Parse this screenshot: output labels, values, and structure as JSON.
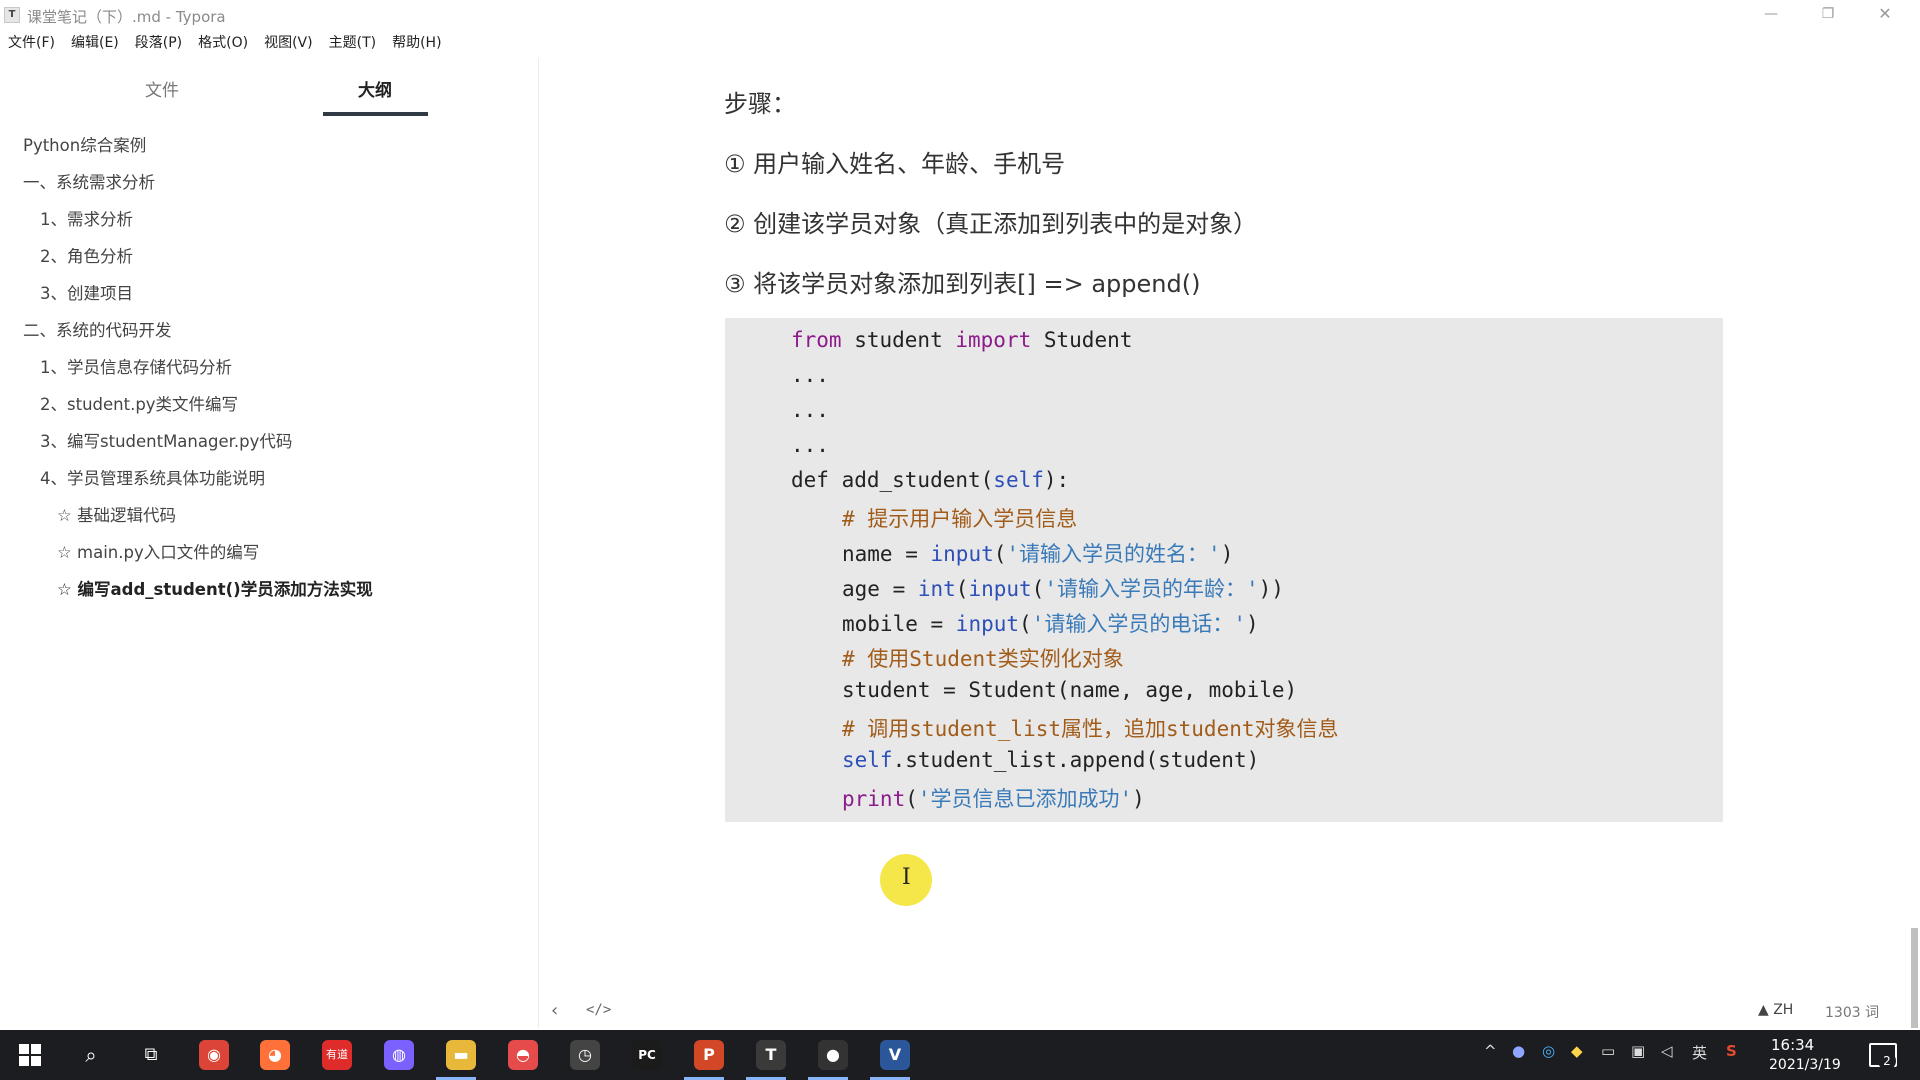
{
  "window": {
    "title": "课堂笔记（下）.md - Typora",
    "app_icon_letter": "T",
    "controls": {
      "minimize": "—",
      "maximize": "❐",
      "close": "✕"
    }
  },
  "menu": [
    "文件(F)",
    "编辑(E)",
    "段落(P)",
    "格式(O)",
    "视图(V)",
    "主题(T)",
    "帮助(H)"
  ],
  "sidebar": {
    "tabs": {
      "files": "文件",
      "outline": "大纲"
    },
    "outline": [
      "Python综合案例",
      "一、系统需求分析",
      "1、需求分析",
      "2、角色分析",
      "3、创建项目",
      "二、系统的代码开发",
      "1、学员信息存储代码分析",
      "2、student.py类文件编写",
      "3、编写studentManager.py代码",
      "4、学员管理系统具体功能说明",
      "☆ 基础逻辑代码",
      "☆ main.py入口文件的编写",
      "☆ 编写add_student()学员添加方法实现"
    ]
  },
  "content": {
    "steps_heading": "步骤：",
    "steps": [
      "① 用户输入姓名、年龄、手机号",
      "② 创建该学员对象（真正添加到列表中的是对象）",
      "③ 将该学员对象添加到列表[] => append()"
    ],
    "code": {
      "l1_kw1": "from",
      "l1_mod": " student ",
      "l1_kw2": "import",
      "l1_cls": " Student",
      "l2": "...",
      "l3": "...",
      "l4": "...",
      "l5_def": "def add_student(",
      "l5_self": "self",
      "l5_end": "):",
      "l6": "# 提示用户输入学员信息",
      "l7_a": "name = ",
      "l7_fn": "input",
      "l7_b": "(",
      "l7_str": "'请输入学员的姓名：'",
      "l7_c": ")",
      "l8_a": "age = ",
      "l8_fn1": "int",
      "l8_b": "(",
      "l8_fn2": "input",
      "l8_c": "(",
      "l8_str": "'请输入学员的年龄：'",
      "l8_d": "))",
      "l9_a": "mobile = ",
      "l9_fn": "input",
      "l9_b": "(",
      "l9_str": "'请输入学员的电话：'",
      "l9_c": ")",
      "l10": "# 使用Student类实例化对象",
      "l11": "student = Student(name, age, mobile)",
      "l12": "# 调用student_list属性，追加student对象信息",
      "l13_self": "self",
      "l13_rest": ".student_list.append(student)",
      "l14_fn": "print",
      "l14_a": "(",
      "l14_str": "'学员信息已添加成功'",
      "l14_b": ")"
    }
  },
  "statusbar": {
    "prev": "‹",
    "source_toggle": "</>",
    "language": "ZH",
    "word_count": "1303 词"
  },
  "taskbar": {
    "apps": [
      {
        "name": "chrome",
        "label": "◉",
        "color": "#db4437"
      },
      {
        "name": "firefox",
        "label": "◕",
        "color": "#ff7139"
      },
      {
        "name": "youdao",
        "label": "有道",
        "color": "#e02b2b"
      },
      {
        "name": "color-app",
        "label": "◍",
        "color": "#7b61ff"
      },
      {
        "name": "file-explorer",
        "label": "▬",
        "color": "#e8b83a"
      },
      {
        "name": "recorder",
        "label": "◓",
        "color": "#e54b4b"
      },
      {
        "name": "clock-app",
        "label": "◷",
        "color": "#444444"
      },
      {
        "name": "pycharm",
        "label": "PC",
        "color": "#1b1b1b"
      },
      {
        "name": "powerpoint",
        "label": "P",
        "color": "#d24726"
      },
      {
        "name": "typora",
        "label": "T",
        "color": "#3a3a3a"
      },
      {
        "name": "record-dot",
        "label": "●",
        "color": "#333333"
      },
      {
        "name": "visio",
        "label": "V",
        "color": "#2b579a"
      }
    ],
    "tray": {
      "ime": "英",
      "caret": "^"
    },
    "clock": {
      "time": "16:34",
      "date": "2021/3/19"
    },
    "notifications": "2"
  }
}
